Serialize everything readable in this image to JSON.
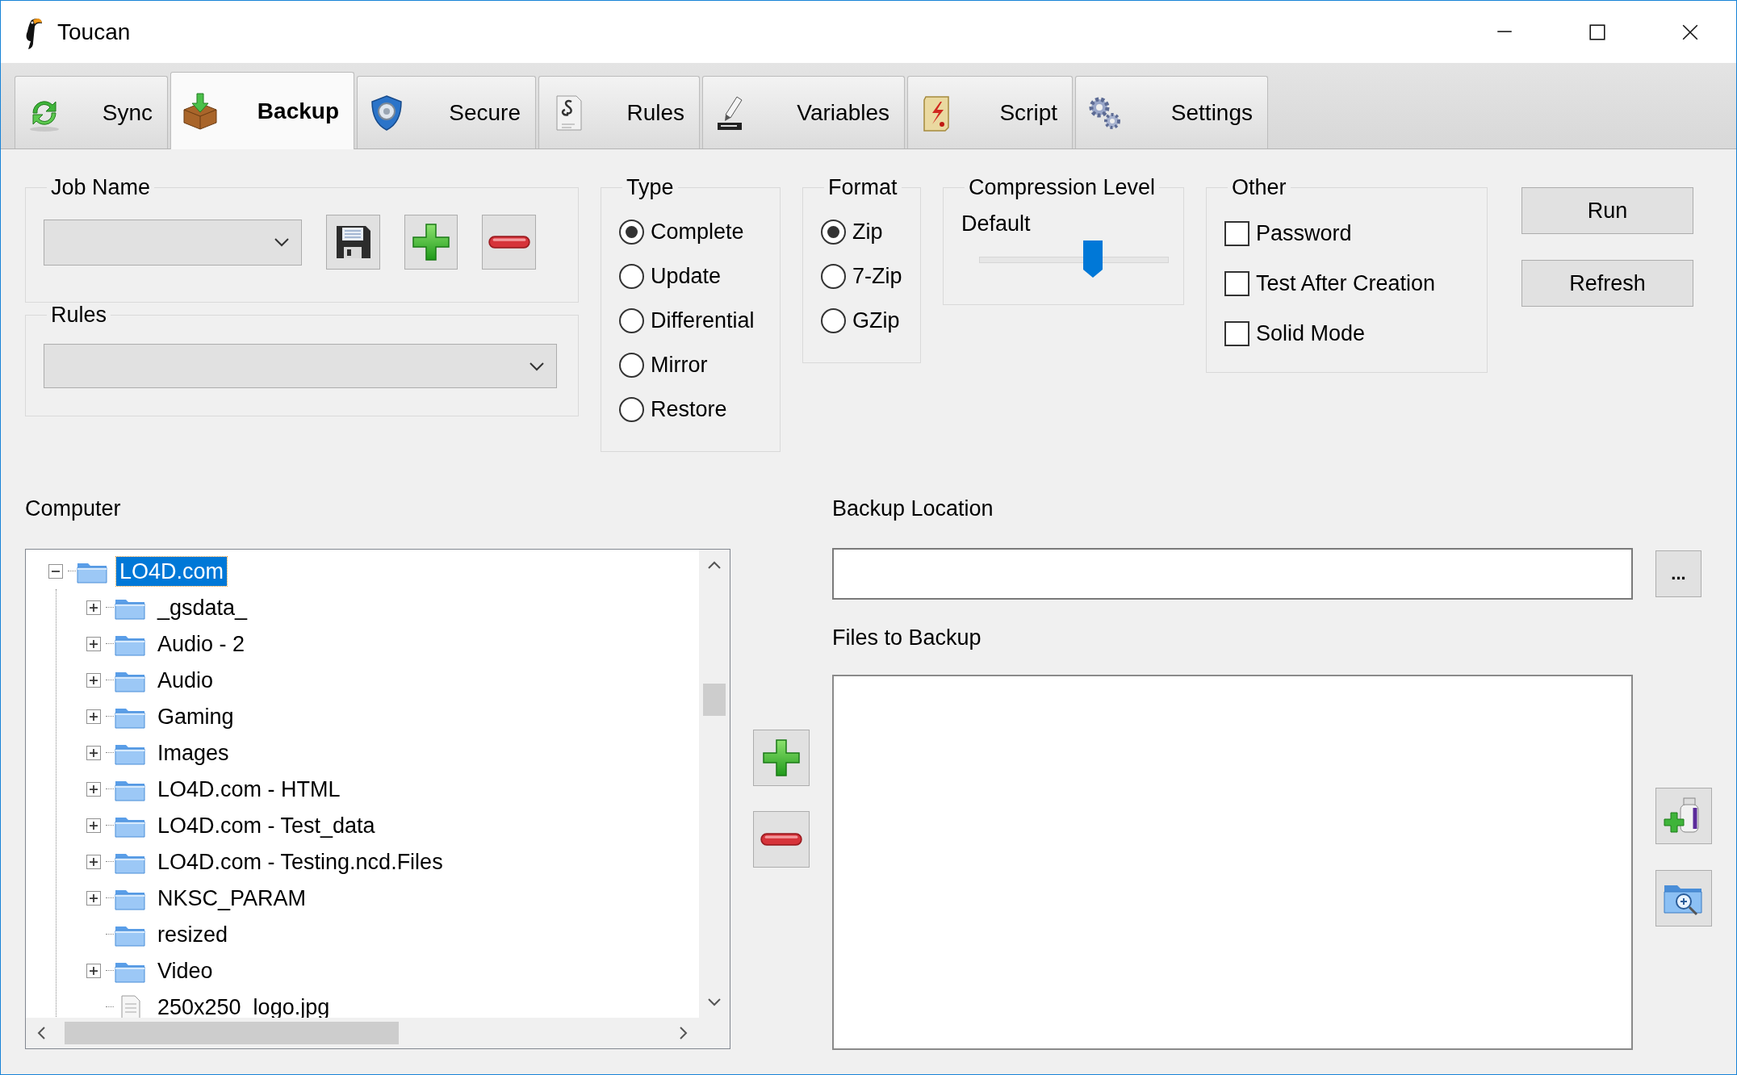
{
  "window": {
    "title": "Toucan"
  },
  "tabs": [
    {
      "label": "Sync",
      "selected": false
    },
    {
      "label": "Backup",
      "selected": true
    },
    {
      "label": "Secure",
      "selected": false
    },
    {
      "label": "Rules",
      "selected": false
    },
    {
      "label": "Variables",
      "selected": false
    },
    {
      "label": "Script",
      "selected": false
    },
    {
      "label": "Settings",
      "selected": false
    }
  ],
  "job_name": {
    "label": "Job Name"
  },
  "rules": {
    "label": "Rules"
  },
  "type": {
    "label": "Type",
    "options": [
      {
        "label": "Complete",
        "selected": true
      },
      {
        "label": "Update",
        "selected": false
      },
      {
        "label": "Differential",
        "selected": false
      },
      {
        "label": "Mirror",
        "selected": false
      },
      {
        "label": "Restore",
        "selected": false
      }
    ]
  },
  "format": {
    "label": "Format",
    "options": [
      {
        "label": "Zip",
        "selected": true
      },
      {
        "label": "7-Zip",
        "selected": false
      },
      {
        "label": "GZip",
        "selected": false
      }
    ]
  },
  "compression": {
    "label": "Compression Level",
    "reading": "Default",
    "level": 0.6
  },
  "other": {
    "label": "Other",
    "options": [
      {
        "label": "Password",
        "checked": false
      },
      {
        "label": "Test After Creation",
        "checked": false
      },
      {
        "label": "Solid Mode",
        "checked": false
      }
    ]
  },
  "buttons": [
    {
      "label": "Run"
    },
    {
      "label": "Refresh"
    }
  ],
  "computer": {
    "label": "Computer",
    "tree": [
      {
        "label": "LO4D.com",
        "kind": "folder",
        "expanded": true,
        "selected": true,
        "children": [
          {
            "label": "_gsdata_",
            "kind": "folder",
            "expanded": false,
            "selected": false
          },
          {
            "label": "Audio - 2",
            "kind": "folder",
            "expanded": false,
            "selected": false
          },
          {
            "label": "Audio",
            "kind": "folder",
            "expanded": false,
            "selected": false
          },
          {
            "label": "Gaming",
            "kind": "folder",
            "expanded": false,
            "selected": false
          },
          {
            "label": "Images",
            "kind": "folder",
            "expanded": false,
            "selected": false
          },
          {
            "label": "LO4D.com - HTML",
            "kind": "folder",
            "expanded": false,
            "selected": false
          },
          {
            "label": "LO4D.com - Test_data",
            "kind": "folder",
            "expanded": false,
            "selected": false
          },
          {
            "label": "LO4D.com - Testing.ncd.Files",
            "kind": "folder",
            "expanded": false,
            "selected": false
          },
          {
            "label": "NKSC_PARAM",
            "kind": "folder",
            "expanded": false,
            "selected": false
          },
          {
            "label": "resized",
            "kind": "folder",
            "selected": false
          },
          {
            "label": "Video",
            "kind": "folder",
            "expanded": false,
            "selected": false
          },
          {
            "label": "250x250_logo.jpg",
            "kind": "file",
            "selected": false
          }
        ]
      }
    ]
  },
  "backup_location": {
    "label": "Backup Location",
    "browse_button": "..."
  },
  "files_to_backup": {
    "label": "Files to Backup"
  }
}
